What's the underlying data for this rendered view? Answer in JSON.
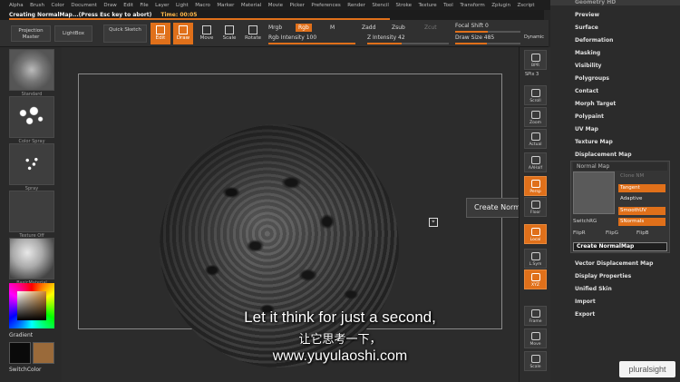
{
  "menu": [
    "Alpha",
    "Brush",
    "Color",
    "Document",
    "Draw",
    "Edit",
    "File",
    "Layer",
    "Light",
    "Macro",
    "Marker",
    "Material",
    "Movie",
    "Picker",
    "Preferences",
    "Render",
    "Stencil",
    "Stroke",
    "Texture",
    "Tool",
    "Transform",
    "Zplugin",
    "Zscript"
  ],
  "status": {
    "message": "Creating NormalMap...(Press Esc key to abort)",
    "time": "Time: 00:05"
  },
  "toolbar": {
    "projection_master": "Projection Master",
    "lightbox": "LightBox",
    "quick_sketch": "Quick Sketch",
    "edit": "Edit",
    "draw": "Draw",
    "move": "Move",
    "scale": "Scale",
    "rotate": "Rotate",
    "mrgb": "Mrgb",
    "rgb": "Rgb",
    "m": "M",
    "rgb_intensity": "Rgb Intensity 100",
    "zadd": "Zadd",
    "zsub": "Zsub",
    "zcut": "Zcut",
    "z_intensity": "Z Intensity 42",
    "focal_shift": "Focal Shift 0",
    "draw_size": "Draw Size 485",
    "dynamic": "Dynamic"
  },
  "leftshelf": {
    "thumbs": [
      "Standard",
      "Color Spray",
      "Spray",
      "Texture Off",
      "BasicMaterial"
    ],
    "gradient_label": "Gradient",
    "switch_color_label": "SwitchColor"
  },
  "rightshelf": {
    "spix": "SPix 3",
    "buttons": [
      "BPR",
      "Scroll",
      "Zoom",
      "Actual",
      "AAHalf",
      "Persp",
      "Floor",
      "Local",
      "L.Sym",
      "XYZ",
      "Frame",
      "Move",
      "Scale"
    ]
  },
  "palette": {
    "items_top": [
      "Geometry HD",
      "Preview",
      "Surface",
      "Deformation",
      "Masking",
      "Visibility",
      "Polygroups",
      "Contact",
      "Morph Target",
      "Polypaint",
      "UV Map",
      "Texture Map",
      "Displacement Map"
    ],
    "normal_map": {
      "header": "Normal Map",
      "clone_nm": "Clone NM",
      "tangent": "Tangent",
      "adaptive": "Adaptive",
      "smooth_uv": "SmoothUV",
      "snormals": "SNormals",
      "switch_rg": "SwitchRG",
      "flip_r": "FlipR",
      "flip_g": "FlipG",
      "flip_b": "FlipB",
      "create": "Create NormalMap"
    },
    "items_bottom": [
      "Vector Displacement Map",
      "Display Properties",
      "Unified Skin",
      "Import",
      "Export"
    ]
  },
  "canvas": {
    "tooltip": "Create Normal Map"
  },
  "subtitles": {
    "english": "Let it think for just a second,",
    "chinese": "让它思考一下，",
    "url": "www.yuyulaoshi.com"
  },
  "watermark": "pluralsight",
  "colors": {
    "accent": "#e0701a",
    "background": "#2b2b2b"
  }
}
